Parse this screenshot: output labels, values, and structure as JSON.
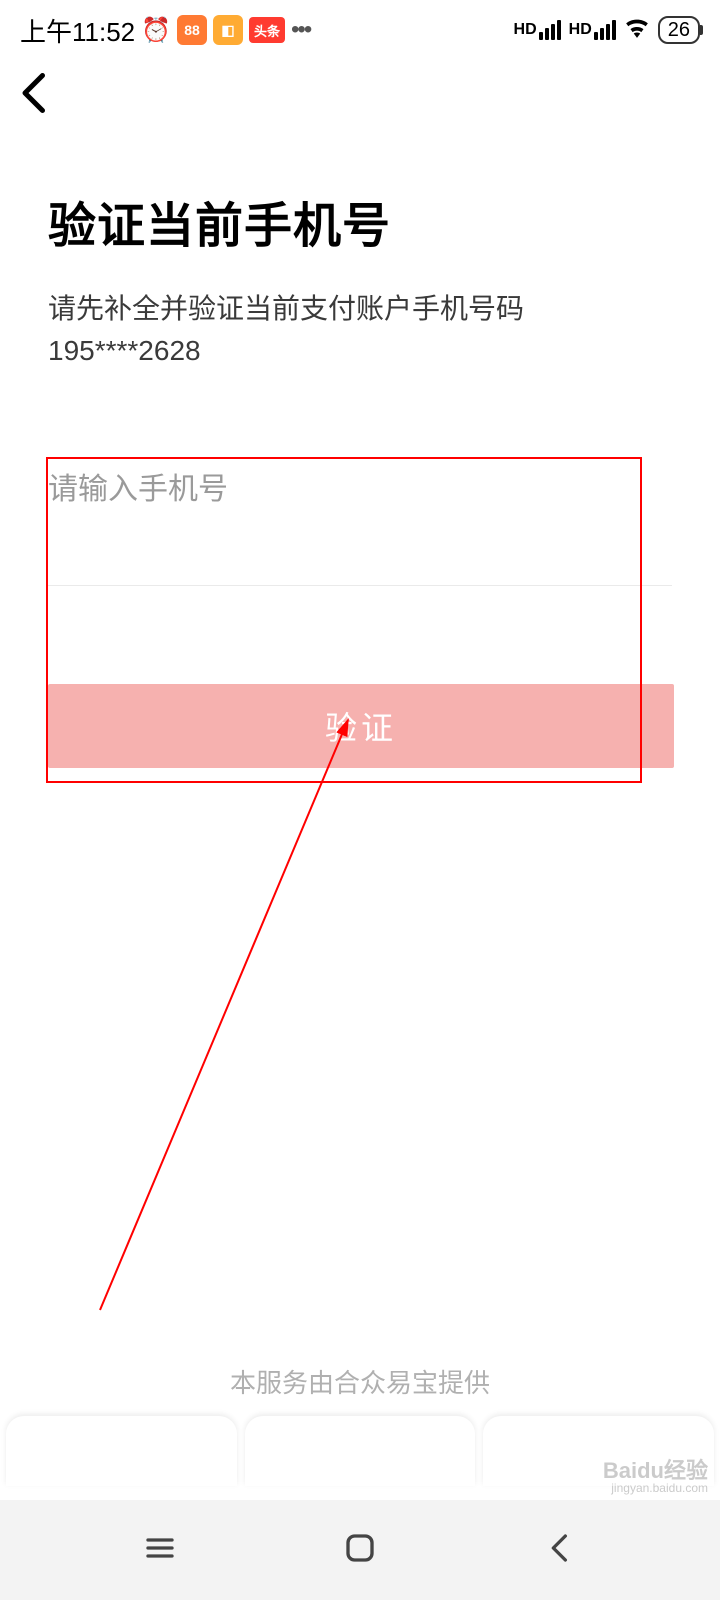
{
  "status": {
    "time": "上午11:52",
    "battery": "26",
    "hd_label": "HD",
    "toutiao_label": "头条"
  },
  "nav": {
    "back": "back"
  },
  "page": {
    "title": "验证当前手机号",
    "subtitle_prefix": "请先补全并验证当前支付账户手机号码 ",
    "masked_phone": "195****2628",
    "input_label": "请输入手机号",
    "verify_label": "验证",
    "footer": "本服务由合众易宝提供"
  },
  "watermark": {
    "main": "Baidu经验",
    "sub": "jingyan.baidu.com"
  }
}
